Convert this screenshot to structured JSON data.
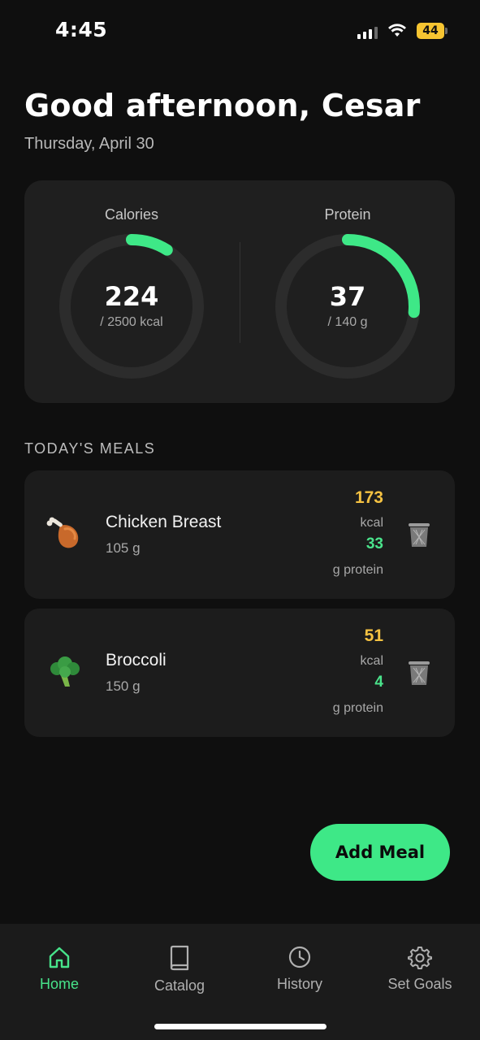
{
  "status_bar": {
    "time": "4:45",
    "battery": "44"
  },
  "header": {
    "greeting": "Good afternoon, Cesar",
    "date": "Thursday, April 30"
  },
  "summary": {
    "calories": {
      "label": "Calories",
      "value": "224",
      "target": "/ 2500 kcal",
      "progress": 0.0896
    },
    "protein": {
      "label": "Protein",
      "value": "37",
      "target": "/ 140 g",
      "progress": 0.264
    }
  },
  "meals_section": {
    "title": "TODAY'S MEALS"
  },
  "meals": [
    {
      "emoji": "🍗",
      "name": "Chicken Breast",
      "weight": "105 g",
      "kcal": "173",
      "kcal_unit": "kcal",
      "protein": "33",
      "protein_unit": "g protein"
    },
    {
      "emoji": "🥦",
      "name": "Broccoli",
      "weight": "150 g",
      "kcal": "51",
      "kcal_unit": "kcal",
      "protein": "4",
      "protein_unit": "g protein"
    }
  ],
  "add_meal": {
    "label": "Add Meal"
  },
  "nav": [
    {
      "label": "Home",
      "icon": "home-icon",
      "active": true
    },
    {
      "label": "Catalog",
      "icon": "book-icon",
      "active": false
    },
    {
      "label": "History",
      "icon": "clock-icon",
      "active": false
    },
    {
      "label": "Set Goals",
      "icon": "gear-icon",
      "active": false
    }
  ],
  "colors": {
    "accent": "#3ee887",
    "kcal": "#f5c242",
    "background": "#0f0f0f",
    "card": "#1f1f1f"
  }
}
